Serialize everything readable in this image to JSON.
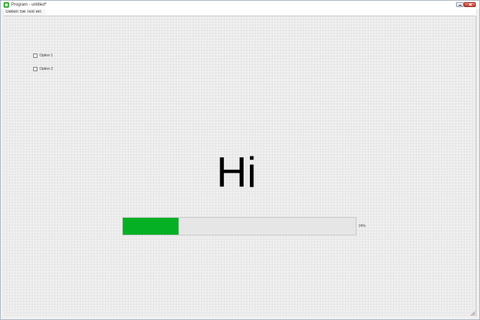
{
  "window": {
    "title": "Program - untitled*",
    "icon": "app-icon",
    "controls": [
      "minimize",
      "close"
    ]
  },
  "input": {
    "placeholder": "Geben Sie Text ein",
    "value": ""
  },
  "checkboxes": [
    {
      "label": "Option 1",
      "checked": false
    },
    {
      "label": "Option 2",
      "checked": false
    }
  ],
  "display": {
    "text": "Hi"
  },
  "progress": {
    "value": 0.24,
    "label": "24%",
    "fill_color": "#06b025"
  }
}
